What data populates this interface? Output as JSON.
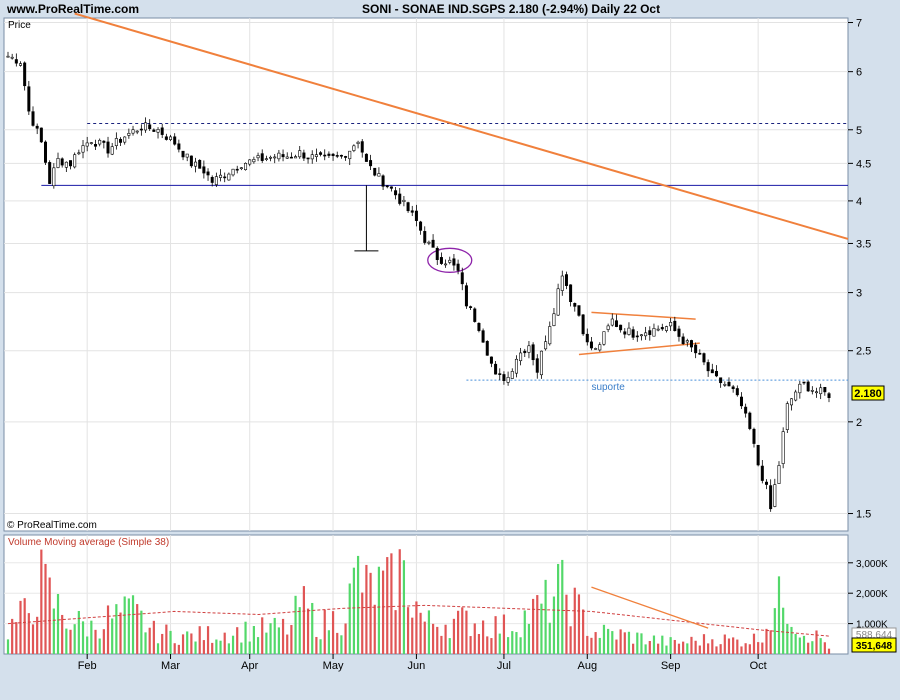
{
  "header": {
    "site": "www.ProRealTime.com",
    "title": "SONI - SONAE IND.SGPS   2.180 (-2.94%)   Daily  22 Oct"
  },
  "chart_data": [
    {
      "type": "candlestick",
      "panel_label": "Price",
      "watermark": "© ProRealTime.com",
      "last_price_label": "2.180",
      "y_scale": "log",
      "ylim": [
        1.42,
        7.1
      ],
      "y_ticks": [
        {
          "v": 7,
          "label": "7"
        },
        {
          "v": 6,
          "label": "6"
        },
        {
          "v": 5,
          "label": "5"
        },
        {
          "v": 4.5,
          "label": "4.5"
        },
        {
          "v": 4,
          "label": "4"
        },
        {
          "v": 3.5,
          "label": "3.5"
        },
        {
          "v": 3,
          "label": "3"
        },
        {
          "v": 2.5,
          "label": "2.5"
        },
        {
          "v": 2,
          "label": "2"
        },
        {
          "v": 1.5,
          "label": "1.5"
        }
      ],
      "x_months": [
        {
          "label": "Feb",
          "i": 19
        },
        {
          "label": "Mar",
          "i": 39
        },
        {
          "label": "Apr",
          "i": 58
        },
        {
          "label": "May",
          "i": 78
        },
        {
          "label": "Jun",
          "i": 98
        },
        {
          "label": "Jul",
          "i": 119
        },
        {
          "label": "Aug",
          "i": 139
        },
        {
          "label": "Sep",
          "i": 159
        },
        {
          "label": "Oct",
          "i": 180
        }
      ],
      "n_bars": 198,
      "anchors": [
        [
          0,
          6.3
        ],
        [
          3,
          6.2
        ],
        [
          5,
          5.3
        ],
        [
          8,
          4.8
        ],
        [
          10,
          4.25
        ],
        [
          12,
          4.55
        ],
        [
          15,
          4.5
        ],
        [
          17,
          4.7
        ],
        [
          20,
          4.85
        ],
        [
          24,
          4.7
        ],
        [
          28,
          4.9
        ],
        [
          32,
          5.05
        ],
        [
          36,
          5.0
        ],
        [
          40,
          4.8
        ],
        [
          44,
          4.5
        ],
        [
          47,
          4.4
        ],
        [
          49,
          4.25
        ],
        [
          52,
          4.35
        ],
        [
          56,
          4.5
        ],
        [
          60,
          4.55
        ],
        [
          64,
          4.6
        ],
        [
          67,
          4.6
        ],
        [
          70,
          4.65
        ],
        [
          72,
          4.6
        ],
        [
          76,
          4.55
        ],
        [
          80,
          4.6
        ],
        [
          82,
          4.7
        ],
        [
          84,
          4.85
        ],
        [
          86,
          4.5
        ],
        [
          89,
          4.3
        ],
        [
          92,
          4.15
        ],
        [
          95,
          3.95
        ],
        [
          98,
          3.75
        ],
        [
          100,
          3.55
        ],
        [
          103,
          3.35
        ],
        [
          106,
          3.3
        ],
        [
          108,
          3.2
        ],
        [
          110,
          2.9
        ],
        [
          113,
          2.7
        ],
        [
          115,
          2.5
        ],
        [
          117,
          2.3
        ],
        [
          120,
          2.3
        ],
        [
          122,
          2.45
        ],
        [
          125,
          2.55
        ],
        [
          127,
          2.35
        ],
        [
          129,
          2.6
        ],
        [
          131,
          2.85
        ],
        [
          133,
          3.2
        ],
        [
          135,
          2.95
        ],
        [
          137,
          2.8
        ],
        [
          139,
          2.55
        ],
        [
          141,
          2.5
        ],
        [
          143,
          2.62
        ],
        [
          145,
          2.75
        ],
        [
          147,
          2.68
        ],
        [
          150,
          2.64
        ],
        [
          153,
          2.66
        ],
        [
          156,
          2.68
        ],
        [
          159,
          2.7
        ],
        [
          161,
          2.62
        ],
        [
          163,
          2.55
        ],
        [
          166,
          2.45
        ],
        [
          169,
          2.3
        ],
        [
          172,
          2.25
        ],
        [
          174,
          2.2
        ],
        [
          176,
          2.1
        ],
        [
          178,
          1.95
        ],
        [
          180,
          1.75
        ],
        [
          182,
          1.62
        ],
        [
          183,
          1.52
        ],
        [
          185,
          1.75
        ],
        [
          187,
          2.1
        ],
        [
          189,
          2.2
        ],
        [
          191,
          2.25
        ],
        [
          194,
          2.2
        ],
        [
          197,
          2.18
        ]
      ],
      "annotations": {
        "resistance_dotted": {
          "value": 5.1,
          "from_i": 19,
          "to_i": 198
        },
        "support_solid": {
          "value": 4.2,
          "from_i": 8,
          "to_i": 198
        },
        "trendline": {
          "from": [
            16,
            7.2
          ],
          "to": [
            198,
            3.55
          ]
        },
        "suporte": {
          "label": "suporte",
          "value": 2.28,
          "from_i": 110,
          "to_i": 198
        },
        "triangle": {
          "upper": [
            [
              140,
              2.82
            ],
            [
              165,
              2.76
            ]
          ],
          "lower": [
            [
              137,
              2.47
            ],
            [
              166,
              2.56
            ]
          ]
        },
        "ellipse": {
          "i": 106,
          "value": 3.32
        },
        "measure": {
          "i": 86,
          "top": 4.2,
          "bottom": 3.42
        }
      }
    },
    {
      "type": "bar",
      "panel_label": "Volume Moving average (Simple 38)",
      "y_ticks": [
        {
          "v": 3000,
          "label": "3,000K"
        },
        {
          "v": 2000,
          "label": "2,000K"
        },
        {
          "v": 1000,
          "label": "1,000K"
        }
      ],
      "ylim": [
        0,
        3750
      ],
      "ma_label": "588,644",
      "last_volume_label": "351,648",
      "peaks": [
        [
          0,
          1100
        ],
        [
          5,
          2000
        ],
        [
          8,
          3300
        ],
        [
          10,
          2600
        ],
        [
          14,
          1600
        ],
        [
          20,
          1200
        ],
        [
          24,
          1600
        ],
        [
          30,
          1900
        ],
        [
          35,
          1000
        ],
        [
          43,
          800
        ],
        [
          60,
          1100
        ],
        [
          68,
          1200
        ],
        [
          70,
          2300
        ],
        [
          75,
          1300
        ],
        [
          80,
          1700
        ],
        [
          82,
          2500
        ],
        [
          84,
          3700
        ],
        [
          86,
          2900
        ],
        [
          92,
          3100
        ],
        [
          94,
          3800
        ],
        [
          100,
          1400
        ],
        [
          110,
          1500
        ],
        [
          120,
          1200
        ],
        [
          126,
          1900
        ],
        [
          130,
          2400
        ],
        [
          132,
          2900
        ],
        [
          134,
          2800
        ],
        [
          140,
          1000
        ],
        [
          146,
          900
        ],
        [
          160,
          500
        ],
        [
          170,
          700
        ],
        [
          175,
          600
        ],
        [
          180,
          700
        ],
        [
          186,
          2700
        ],
        [
          190,
          1100
        ],
        [
          195,
          700
        ],
        [
          197,
          350
        ]
      ],
      "ma_series": [
        [
          0,
          1000
        ],
        [
          20,
          1200
        ],
        [
          40,
          1400
        ],
        [
          60,
          1300
        ],
        [
          80,
          1500
        ],
        [
          100,
          1600
        ],
        [
          120,
          1500
        ],
        [
          140,
          1400
        ],
        [
          160,
          1100
        ],
        [
          180,
          800
        ],
        [
          197,
          588
        ]
      ],
      "trendline": {
        "from": [
          140,
          2200
        ],
        "to": [
          168,
          850
        ]
      }
    }
  ]
}
